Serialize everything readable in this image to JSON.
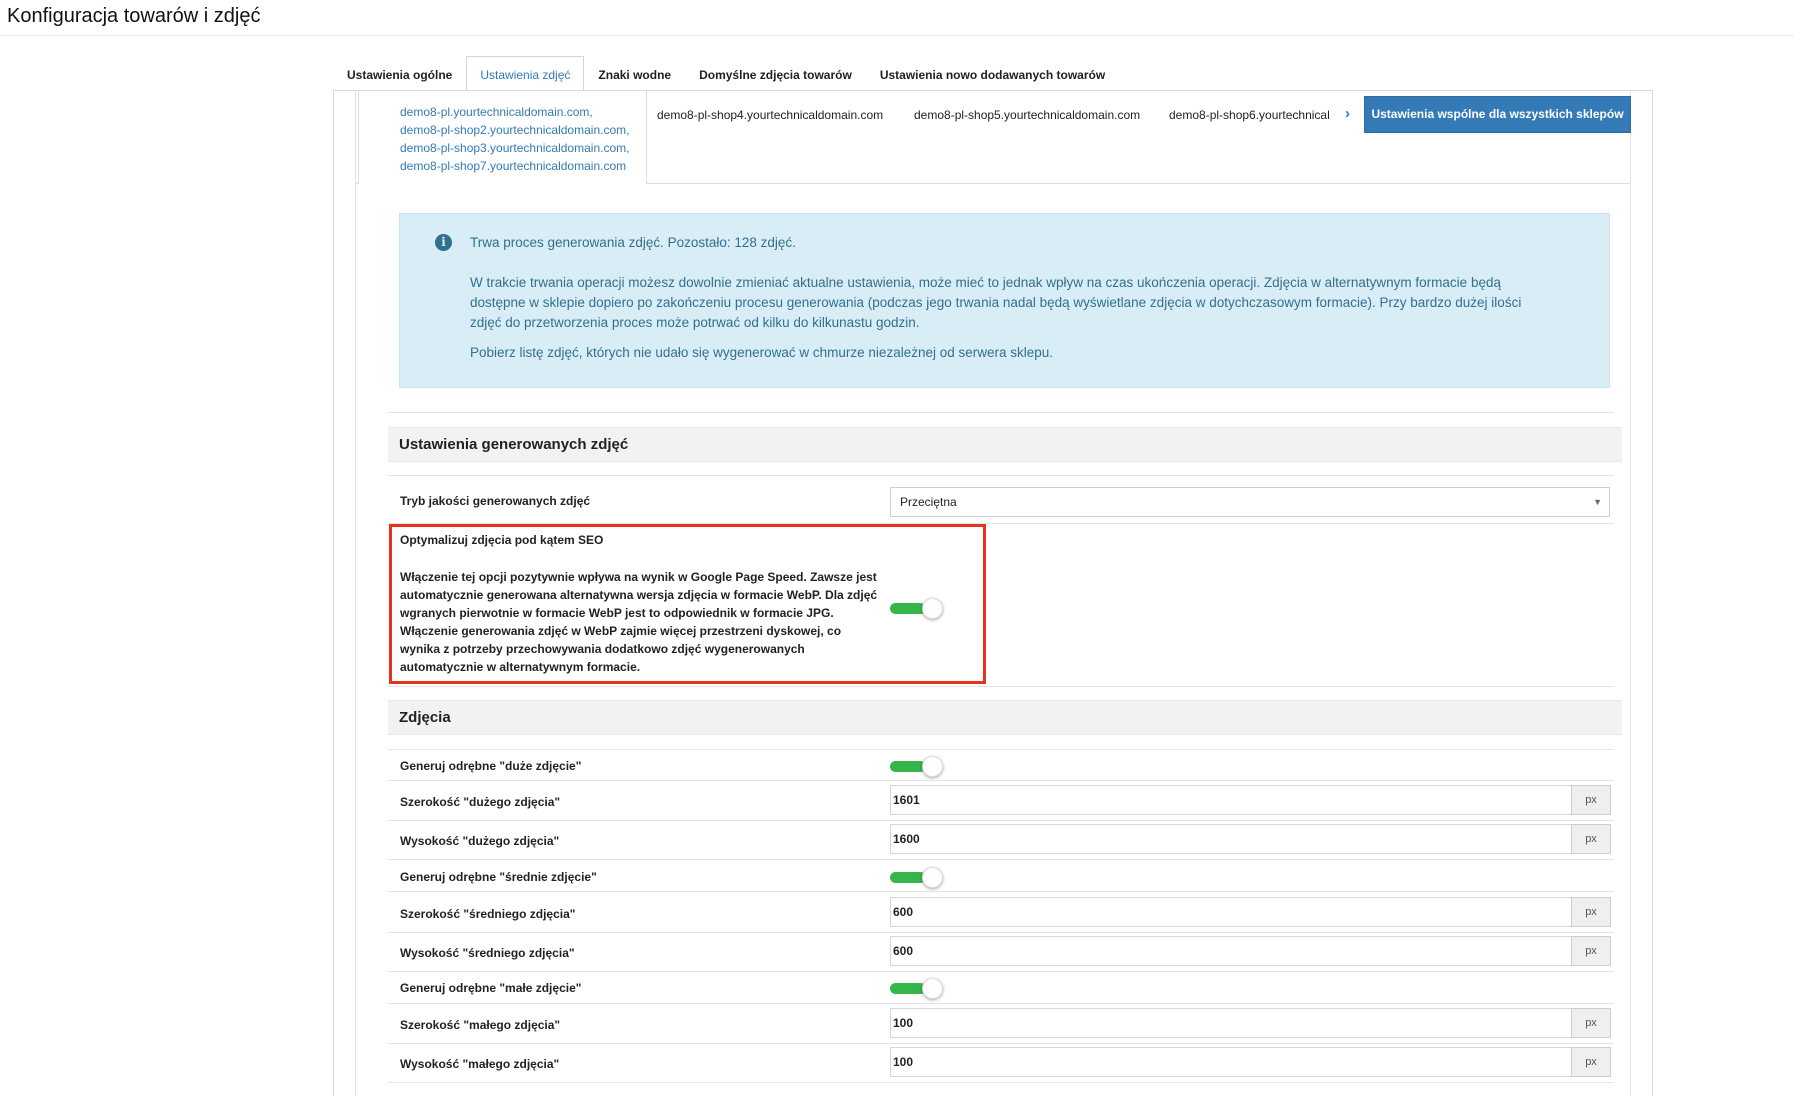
{
  "page": {
    "title": "Konfiguracja towarów i zdjęć"
  },
  "tabs": [
    {
      "label": "Ustawienia ogólne"
    },
    {
      "label": "Ustawienia zdjęć"
    },
    {
      "label": "Znaki wodne"
    },
    {
      "label": "Domyślne zdjęcia towarów"
    },
    {
      "label": "Ustawienia nowo dodawanych towarów"
    }
  ],
  "shops": {
    "active_group": [
      "demo8-pl.yourtechnicaldomain.com,",
      "demo8-pl-shop2.yourtechnicaldomain.com,",
      "demo8-pl-shop3.yourtechnicaldomain.com,",
      "demo8-pl-shop7.yourtechnicaldomain.com"
    ],
    "others": [
      "demo8-pl-shop4.yourtechnicaldomain.com",
      "demo8-pl-shop5.yourtechnicaldomain.com",
      "demo8-pl-shop6.yourtechnical"
    ],
    "prev_icon": "‹",
    "next_icon": "›",
    "common_button": "Ustawienia wspólne dla wszystkich sklepów"
  },
  "alert": {
    "icon": "i",
    "heading": "Trwa proces generowania zdjęć. Pozostało: 128 zdjęć.",
    "body_lines": [
      "W trakcie trwania operacji możesz dowolnie zmieniać aktualne ustawienia, może mieć to jednak wpływ na czas ukończenia operacji. Zdjęcia w alternatywnym formacie będą",
      "dostępne w sklepie dopiero po zakończeniu procesu generowania (podczas jego trwania nadal będą wyświetlane zdjęcia w dotychczasowym formacie). Przy bardzo dużej ilości",
      "zdjęć do przetworzenia proces może potrwać od kilku do kilkunastu godzin."
    ],
    "link": "Pobierz listę zdjęć, których nie udało się wygenerować w chmurze niezależnej od serwera sklepu."
  },
  "generated": {
    "section_title": "Ustawienia generowanych zdjęć",
    "quality_label": "Tryb jakości generowanych zdjęć",
    "quality_value": "Przeciętna",
    "seo_title": "Optymalizuj zdjęcia pod kątem SEO",
    "seo_description": "Włączenie tej opcji pozytywnie wpływa na wynik w Google Page Speed. Zawsze jest automatycznie generowana alternatywna wersja zdjęcia w formacie WebP. Dla zdjęć wgranych pierwotnie w formacie WebP jest to odpowiednik w formacie JPG. Włączenie generowania zdjęć w WebP zajmie więcej przestrzeni dyskowej, co wynika z potrzeby przechowywania dodatkowo zdjęć wygenerowanych automatycznie w alternatywnym formacie.",
    "seo_enabled": true
  },
  "photos": {
    "section_title": "Zdjęcia",
    "unit": "px",
    "rows": [
      {
        "type": "toggle",
        "label": "Generuj odrębne \"duże zdjęcie\"",
        "on": true
      },
      {
        "type": "input",
        "label": "Szerokość \"dużego zdjęcia\"",
        "value": "1601"
      },
      {
        "type": "input",
        "label": "Wysokość \"dużego zdjęcia\"",
        "value": "1600"
      },
      {
        "type": "toggle",
        "label": "Generuj odrębne \"średnie zdjęcie\"",
        "on": true
      },
      {
        "type": "input",
        "label": "Szerokość \"średniego zdjęcia\"",
        "value": "600"
      },
      {
        "type": "input",
        "label": "Wysokość \"średniego zdjęcia\"",
        "value": "600"
      },
      {
        "type": "toggle",
        "label": "Generuj odrębne \"małe zdjęcie\"",
        "on": true
      },
      {
        "type": "input",
        "label": "Szerokość \"małego zdjęcia\"",
        "value": "100"
      },
      {
        "type": "input",
        "label": "Wysokość \"małego zdjęcia\"",
        "value": "100"
      }
    ]
  }
}
